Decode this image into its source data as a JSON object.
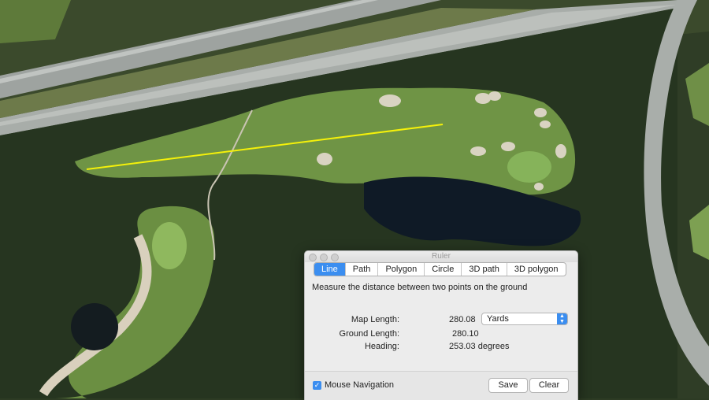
{
  "window": {
    "title": "Ruler"
  },
  "tabs": [
    {
      "label": "Line",
      "active": true
    },
    {
      "label": "Path",
      "active": false
    },
    {
      "label": "Polygon",
      "active": false
    },
    {
      "label": "Circle",
      "active": false
    },
    {
      "label": "3D path",
      "active": false
    },
    {
      "label": "3D polygon",
      "active": false
    }
  ],
  "description": "Measure the distance between two points on the ground",
  "measurements": {
    "map_length_label": "Map Length:",
    "map_length_value": "280.08",
    "units": "Yards",
    "ground_length_label": "Ground Length:",
    "ground_length_value": "280.10",
    "heading_label": "Heading:",
    "heading_value": "253.03 degrees"
  },
  "bottom": {
    "mouse_navigation_label": "Mouse Navigation",
    "mouse_navigation_checked": true,
    "save_label": "Save",
    "clear_label": "Clear"
  },
  "colors": {
    "accent": "#3b8ef0",
    "measure_line": "#f5f10a"
  }
}
